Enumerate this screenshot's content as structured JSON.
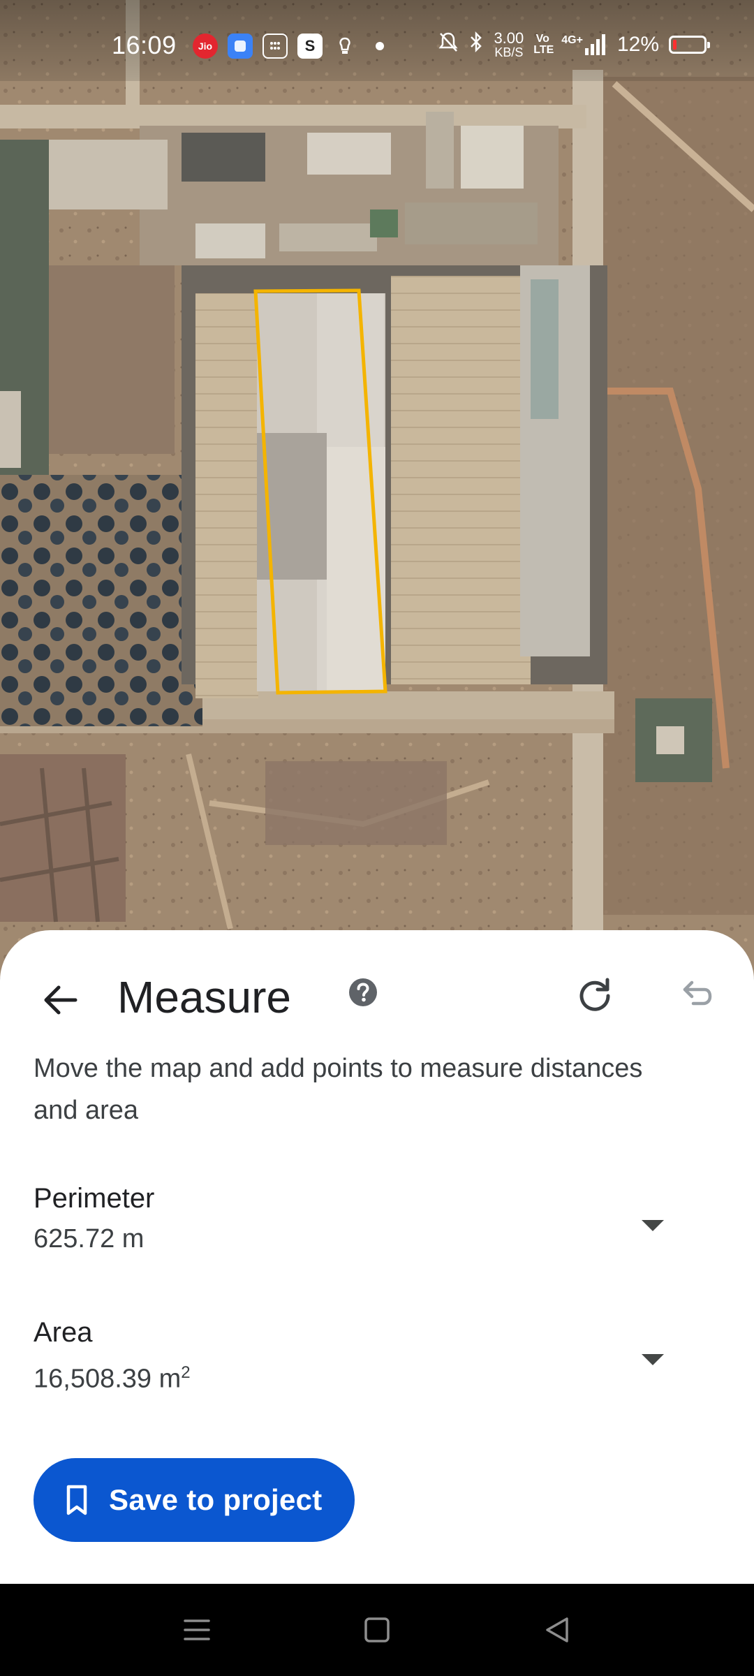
{
  "status_bar": {
    "time": "16:09",
    "notification_icons": [
      {
        "icon": "jio-icon",
        "text": "Jio",
        "color": "#e3262f"
      },
      {
        "icon": "app-blue-icon",
        "text": "",
        "color": "#3b82f6"
      },
      {
        "icon": "calculator-icon",
        "text": "",
        "color": "#777777"
      },
      {
        "icon": "s-app-icon",
        "text": "S",
        "color": "#222222"
      },
      {
        "icon": "bulb-icon",
        "text": "",
        "color": "transparent"
      }
    ],
    "net_speed_value": "3.00",
    "net_speed_unit": "KB/S",
    "volte_label": "Vo LTE",
    "network_label": "4G+",
    "battery_percent": "12%",
    "battery_level": 0.12
  },
  "map": {
    "highlight_color": "#f4b400"
  },
  "measure_panel": {
    "title": "Measure",
    "instructions": "Move the map and add points to measure distances and area",
    "perimeter": {
      "label": "Perimeter",
      "value": "625.72 m"
    },
    "area": {
      "label": "Area",
      "value": "16,508.39 m",
      "unit_superscript": "2"
    },
    "save_button_label": "Save to project",
    "accent_color": "#0b57d0"
  },
  "nav_bar": {
    "buttons": [
      "recents-button",
      "home-button",
      "back-nav-button"
    ]
  }
}
